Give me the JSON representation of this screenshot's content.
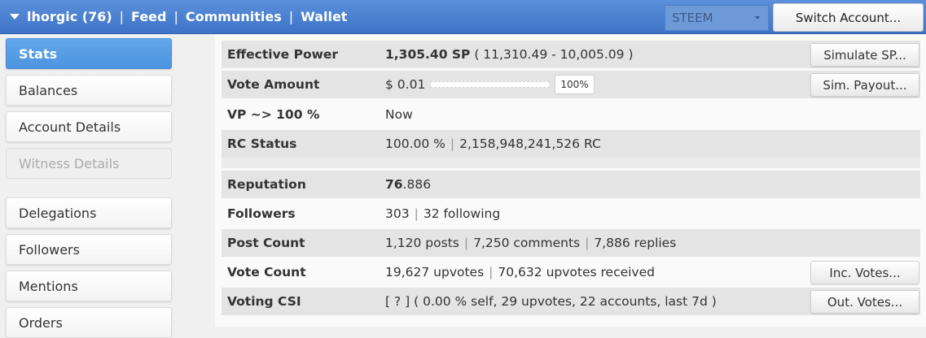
{
  "header": {
    "account": "lhorgic (76)",
    "nav": [
      "Feed",
      "Communities",
      "Wallet"
    ],
    "separator": "|",
    "chain_select": "STEEM",
    "switch_button": "Switch Account..."
  },
  "sidebar": {
    "items": [
      {
        "label": "Stats",
        "state": "active"
      },
      {
        "label": "Balances",
        "state": "normal"
      },
      {
        "label": "Account Details",
        "state": "normal"
      },
      {
        "label": "Witness Details",
        "state": "disabled"
      },
      {
        "label": "Delegations",
        "state": "normal"
      },
      {
        "label": "Followers",
        "state": "normal"
      },
      {
        "label": "Mentions",
        "state": "normal"
      },
      {
        "label": "Orders",
        "state": "normal"
      }
    ]
  },
  "stats": {
    "effective_power": {
      "label": "Effective Power",
      "sp": "1,305.40 SP",
      "detail": " ( 11,310.49 - 10,005.09 )",
      "button": "Simulate SP..."
    },
    "vote_amount": {
      "label": "Vote Amount",
      "value": "$ 0.01",
      "percent": "100%",
      "button": "Sim. Payout..."
    },
    "vp": {
      "label": "VP ~> 100 %",
      "value": "Now"
    },
    "rc_status": {
      "label": "RC Status",
      "percent": "100.00 %",
      "rc": "2,158,948,241,526 RC"
    },
    "reputation": {
      "label": "Reputation",
      "int": "76",
      "dec": ".886"
    },
    "followers": {
      "label": "Followers",
      "followers": "303",
      "following": "32 following"
    },
    "post_count": {
      "label": "Post Count",
      "posts": "1,120 posts",
      "comments": "7,250 comments",
      "replies": "7,886 replies"
    },
    "vote_count": {
      "label": "Vote Count",
      "upvotes": "19,627 upvotes",
      "received": "70,632 upvotes received",
      "button": "Inc. Votes..."
    },
    "voting_csi": {
      "label": "Voting CSI",
      "value": "[ ? ] ( 0.00 % self, 29 upvotes, 22 accounts, last 7d )",
      "button": "Out. Votes..."
    }
  }
}
